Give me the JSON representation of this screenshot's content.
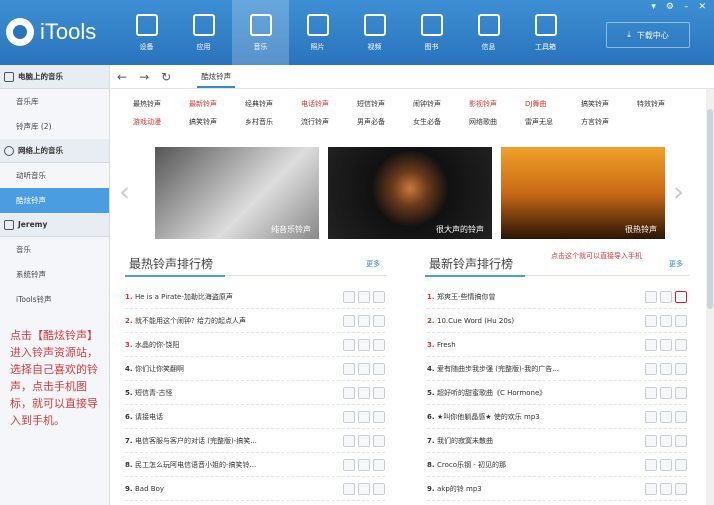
{
  "app": {
    "logo_text": "iTools",
    "download_label": "下载中心"
  },
  "nav": [
    {
      "label": "设备",
      "icon": "phone-icon"
    },
    {
      "label": "应用",
      "icon": "apps-icon"
    },
    {
      "label": "音乐",
      "icon": "music-icon",
      "active": true
    },
    {
      "label": "照片",
      "icon": "photo-icon"
    },
    {
      "label": "视频",
      "icon": "video-icon"
    },
    {
      "label": "图书",
      "icon": "book-icon"
    },
    {
      "label": "信息",
      "icon": "contact-icon"
    },
    {
      "label": "工具箱",
      "icon": "tools-icon"
    }
  ],
  "sidebar": {
    "sec1": "电脑上的音乐",
    "s1_items": [
      "音乐库",
      "铃声库 (2)"
    ],
    "sec2": "网络上的音乐",
    "s2_items": [
      "动听音乐",
      "酷炫铃声"
    ],
    "sec3": "Jeremy",
    "s3_items": [
      "音乐",
      "系统铃声",
      "iTools铃声"
    ]
  },
  "note": "点击【酷炫铃声】进入铃声资源站，选择自己喜欢的铃声，点击手机图标，就可以直接导入到手机。",
  "tab": "酷炫铃声",
  "categories": [
    {
      "t": "最热铃声",
      "r": false
    },
    {
      "t": "最新铃声",
      "r": true
    },
    {
      "t": "经典铃声",
      "r": false
    },
    {
      "t": "电话铃声",
      "r": true
    },
    {
      "t": "短信铃声",
      "r": false
    },
    {
      "t": "闹钟铃声",
      "r": false
    },
    {
      "t": "影视铃声",
      "r": true
    },
    {
      "t": "DJ舞曲",
      "r": true
    },
    {
      "t": "搞笑铃声",
      "r": false
    },
    {
      "t": "特效铃声",
      "r": false
    },
    {
      "t": "游戏动漫",
      "r": true
    },
    {
      "t": "搞笑铃声",
      "r": false
    },
    {
      "t": "乡村音乐",
      "r": false
    },
    {
      "t": "流行铃声",
      "r": false
    },
    {
      "t": "男声必备",
      "r": false
    },
    {
      "t": "女生必备",
      "r": false
    },
    {
      "t": "网络歌曲",
      "r": false
    },
    {
      "t": "雷声无息",
      "r": false
    },
    {
      "t": "方言铃声",
      "r": false
    },
    {
      "t": "",
      "r": false
    }
  ],
  "banners": [
    "纯音乐铃声",
    "很大声的铃声",
    "很热铃声"
  ],
  "left": {
    "title": "最热铃声排行榜",
    "more": "更多",
    "rows": [
      "He is a Pirate-加勒比海盗原声",
      "就不能用这个闹钟? 给力的起点人声",
      "水晶的你-饶阳",
      "你们让你笑翻啊",
      "短信青-古怪",
      "请接电话",
      "电信客服与客户的对话 (完整版)-搞笑...",
      "民工怎么玩阿电信语音小姐的-搞笑铃...",
      "Bad Boy"
    ]
  },
  "right": {
    "title": "最新铃声排行榜",
    "more": "更多",
    "annotation": "点击这个就可以直接导入手机",
    "rows": [
      "郑爽王-些情搞你曾",
      "10.Cue Word (Hu 20s)",
      "Fresh",
      "爱有随曲步我步强 (完整版)-我的广告...",
      "超好听的甜蜜歌曲《C Hormone》",
      "★叫你他躺晶感★ 使的欢乐 mp3",
      "我们的寂寞未散曲",
      "Croco乐钢 - 初见的那",
      "akp的铃 mp3"
    ]
  }
}
